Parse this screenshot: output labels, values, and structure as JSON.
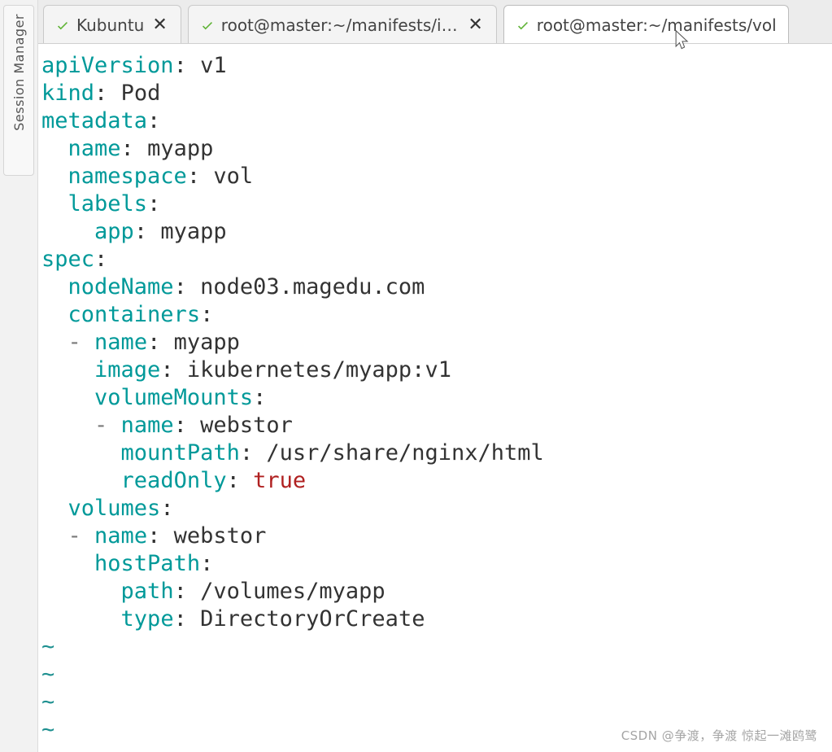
{
  "sidebar": {
    "label": "Session Manager"
  },
  "tabs": [
    {
      "label": "Kubuntu",
      "active": false,
      "closeable": true
    },
    {
      "label": "root@master:~/manifests/ingres",
      "active": false,
      "closeable": true
    },
    {
      "label": "root@master:~/manifests/vol",
      "active": true,
      "closeable": false
    }
  ],
  "yaml": {
    "apiVersion": "v1",
    "kind": "Pod",
    "metadata_name": "myapp",
    "metadata_namespace": "vol",
    "metadata_labels_app": "myapp",
    "spec_nodeName": "node03.magedu.com",
    "container_name": "myapp",
    "container_image": "ikubernetes/myapp:v1",
    "vm_name": "webstor",
    "vm_mountPath": "/usr/share/nginx/html",
    "vm_readOnly": "true",
    "vol_name": "webstor",
    "vol_hostPath_path": "/volumes/myapp",
    "vol_hostPath_type": "DirectoryOrCreate"
  },
  "keys": {
    "apiVersion": "apiVersion",
    "kind": "kind",
    "metadata": "metadata",
    "name": "name",
    "namespace": "namespace",
    "labels": "labels",
    "app": "app",
    "spec": "spec",
    "nodeName": "nodeName",
    "containers": "containers",
    "image": "image",
    "volumeMounts": "volumeMounts",
    "mountPath": "mountPath",
    "readOnly": "readOnly",
    "volumes": "volumes",
    "hostPath": "hostPath",
    "path": "path",
    "type": "type"
  },
  "tilde": "~",
  "watermark": "CSDN @争渡，争渡 惊起一滩鸥鹭"
}
